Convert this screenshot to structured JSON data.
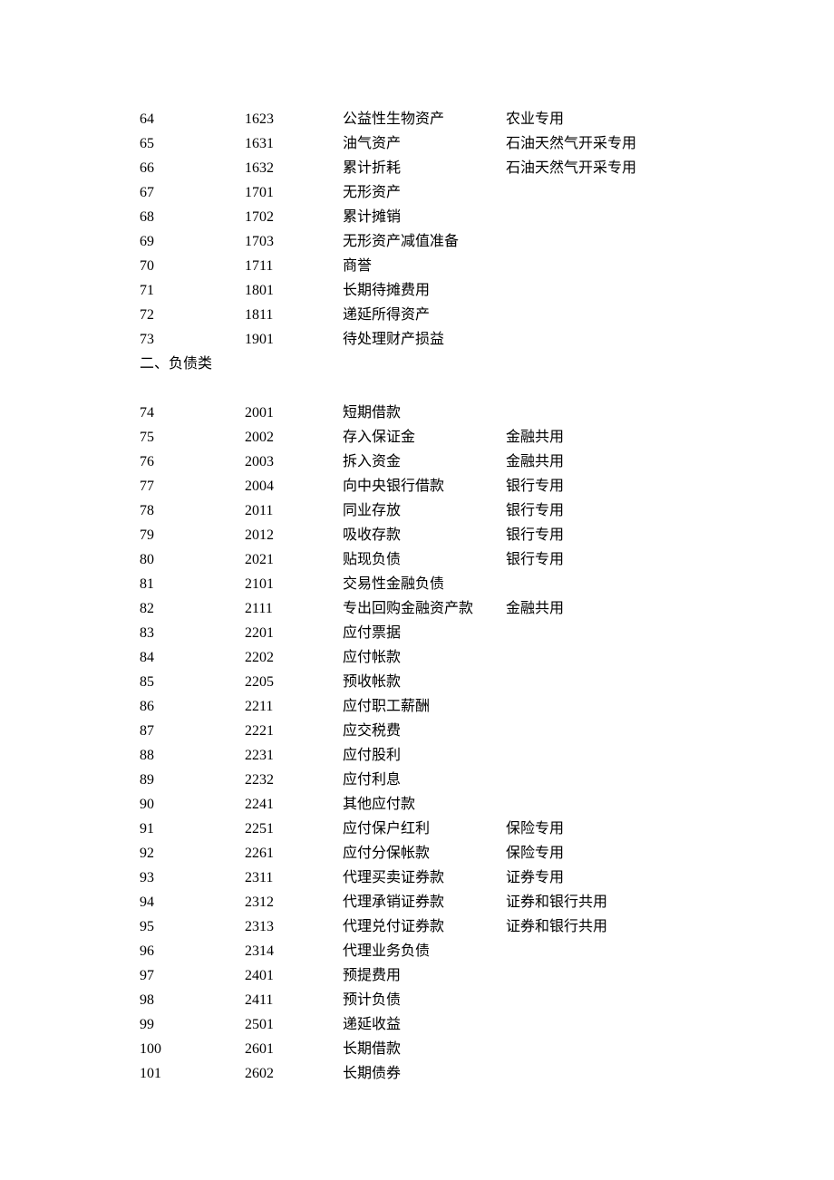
{
  "section_label": "二、负债类",
  "rows_top": [
    {
      "seq": "64",
      "code": "1623",
      "name": "公益性生物资产",
      "note": "农业专用"
    },
    {
      "seq": "65",
      "code": "1631",
      "name": "油气资产",
      "note": "石油天然气开采专用"
    },
    {
      "seq": "66",
      "code": "1632",
      "name": "累计折耗",
      "note": "石油天然气开采专用"
    },
    {
      "seq": "67",
      "code": "1701",
      "name": "无形资产",
      "note": ""
    },
    {
      "seq": "68",
      "code": "1702",
      "name": "累计摊销",
      "note": ""
    },
    {
      "seq": "69",
      "code": "1703",
      "name": "无形资产减值准备",
      "note": ""
    },
    {
      "seq": "70",
      "code": "1711",
      "name": "商誉",
      "note": ""
    },
    {
      "seq": "71",
      "code": "1801",
      "name": "长期待摊费用",
      "note": ""
    },
    {
      "seq": "72",
      "code": "1811",
      "name": "递延所得资产",
      "note": ""
    },
    {
      "seq": "73",
      "code": "1901",
      "name": "待处理财产损益",
      "note": ""
    }
  ],
  "rows_bottom": [
    {
      "seq": "74",
      "code": "2001",
      "name": "短期借款",
      "note": ""
    },
    {
      "seq": "75",
      "code": "2002",
      "name": "存入保证金",
      "note": "金融共用"
    },
    {
      "seq": "76",
      "code": "2003",
      "name": "拆入资金",
      "note": "金融共用"
    },
    {
      "seq": "77",
      "code": "2004",
      "name": "向中央银行借款",
      "note": "银行专用"
    },
    {
      "seq": "78",
      "code": "2011",
      "name": "同业存放",
      "note": "银行专用"
    },
    {
      "seq": "79",
      "code": "2012",
      "name": "吸收存款",
      "note": "银行专用"
    },
    {
      "seq": "80",
      "code": "2021",
      "name": "贴现负债",
      "note": "银行专用"
    },
    {
      "seq": "81",
      "code": "2101",
      "name": "交易性金融负债",
      "note": ""
    },
    {
      "seq": "82",
      "code": "2111",
      "name": "专出回购金融资产款",
      "note": "金融共用"
    },
    {
      "seq": "83",
      "code": "2201",
      "name": "应付票据",
      "note": ""
    },
    {
      "seq": "84",
      "code": "2202",
      "name": "应付帐款",
      "note": ""
    },
    {
      "seq": "85",
      "code": "2205",
      "name": "预收帐款",
      "note": ""
    },
    {
      "seq": "86",
      "code": "2211",
      "name": "应付职工薪酬",
      "note": ""
    },
    {
      "seq": "87",
      "code": "2221",
      "name": "应交税费",
      "note": ""
    },
    {
      "seq": "88",
      "code": "2231",
      "name": "应付股利",
      "note": ""
    },
    {
      "seq": "89",
      "code": "2232",
      "name": "应付利息",
      "note": ""
    },
    {
      "seq": "90",
      "code": "2241",
      "name": "其他应付款",
      "note": ""
    },
    {
      "seq": "91",
      "code": "2251",
      "name": "应付保户红利",
      "note": "保险专用"
    },
    {
      "seq": "92",
      "code": "2261",
      "name": "应付分保帐款",
      "note": "保险专用"
    },
    {
      "seq": "93",
      "code": "2311",
      "name": "代理买卖证券款",
      "note": "证券专用"
    },
    {
      "seq": "94",
      "code": "2312",
      "name": "代理承销证券款",
      "note": "证券和银行共用"
    },
    {
      "seq": "95",
      "code": "2313",
      "name": "代理兑付证券款",
      "note": "证券和银行共用"
    },
    {
      "seq": "96",
      "code": "2314",
      "name": "代理业务负债",
      "note": ""
    },
    {
      "seq": "97",
      "code": "2401",
      "name": "预提费用",
      "note": ""
    },
    {
      "seq": "98",
      "code": "2411",
      "name": "预计负债",
      "note": ""
    },
    {
      "seq": "99",
      "code": "2501",
      "name": "递延收益",
      "note": ""
    },
    {
      "seq": "100",
      "code": "2601",
      "name": "长期借款",
      "note": ""
    },
    {
      "seq": "101",
      "code": "2602",
      "name": "长期债券",
      "note": ""
    }
  ]
}
